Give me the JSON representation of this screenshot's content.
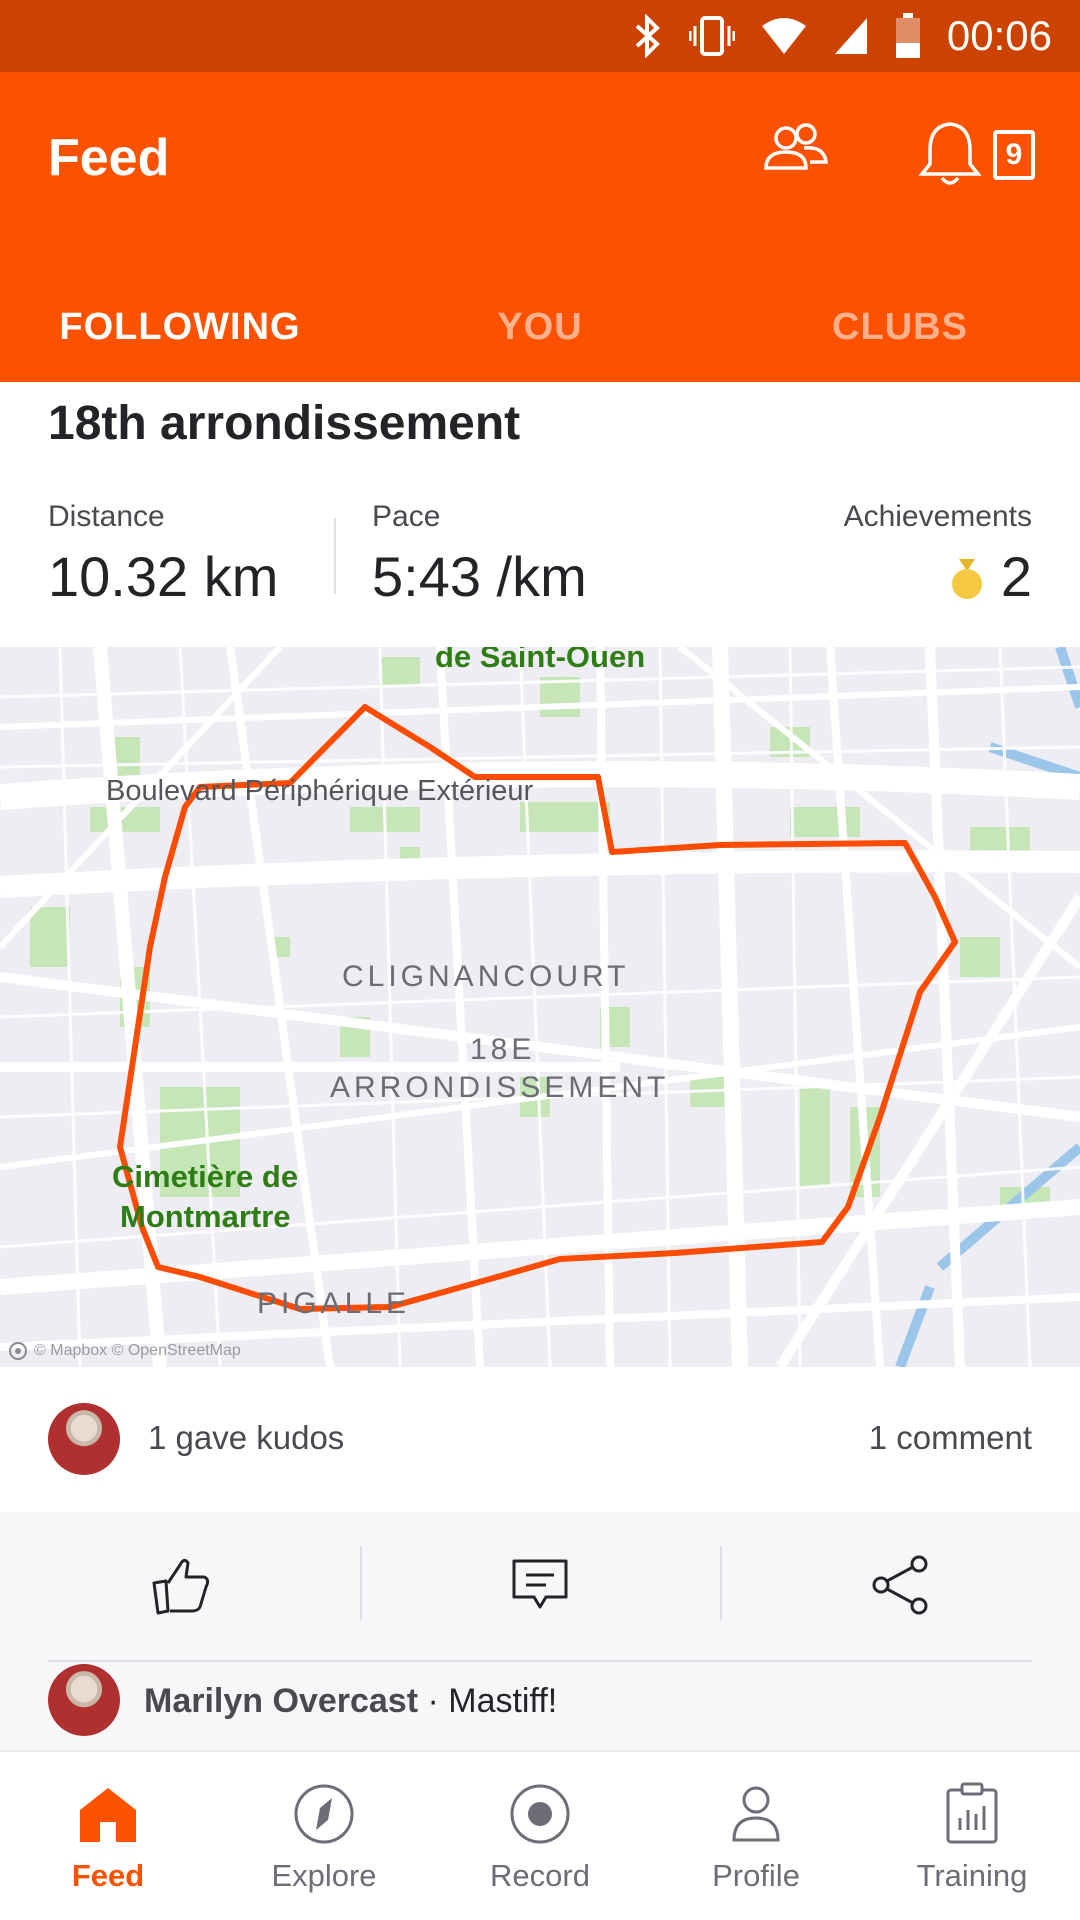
{
  "status_bar": {
    "time": "00:06"
  },
  "header": {
    "title": "Feed",
    "notification_count": "9",
    "tabs": [
      {
        "label": "FOLLOWING",
        "active": true
      },
      {
        "label": "YOU",
        "active": false
      },
      {
        "label": "CLUBS",
        "active": false
      }
    ]
  },
  "activity": {
    "title": "18th arrondissement",
    "stats": {
      "distance": {
        "label": "Distance",
        "value": "10.32 km"
      },
      "pace": {
        "label": "Pace",
        "value": "5:43 /km"
      },
      "achievements": {
        "label": "Achievements",
        "value": "2"
      }
    },
    "map": {
      "labels": {
        "saint_ouen": "de Saint-Ouen",
        "boulevard": "Boulevard Périphérique Extérieur",
        "clignancourt": "CLIGNANCOURT",
        "arr_line1": "18E",
        "arr_line2": "ARRONDISSEMENT",
        "cemetery_line1": "Cimetière de",
        "cemetery_line2": "Montmartre",
        "pigalle": "PIGALLE",
        "attribution": "© Mapbox © OpenStreetMap"
      },
      "route_color": "#fc4c02"
    },
    "kudos_text": "1 gave kudos",
    "comment_count": "1 comment"
  },
  "comment": {
    "author": "Marilyn Overcast",
    "separator": " · ",
    "text": "Mastiff!"
  },
  "bottom_nav": [
    {
      "label": "Feed",
      "icon": "home-icon",
      "active": true
    },
    {
      "label": "Explore",
      "icon": "compass-icon",
      "active": false
    },
    {
      "label": "Record",
      "icon": "record-icon",
      "active": false
    },
    {
      "label": "Profile",
      "icon": "person-icon",
      "active": false
    },
    {
      "label": "Training",
      "icon": "clipboard-chart-icon",
      "active": false
    }
  ],
  "colors": {
    "brand": "#fc5200",
    "status_bar": "#cc4200"
  }
}
